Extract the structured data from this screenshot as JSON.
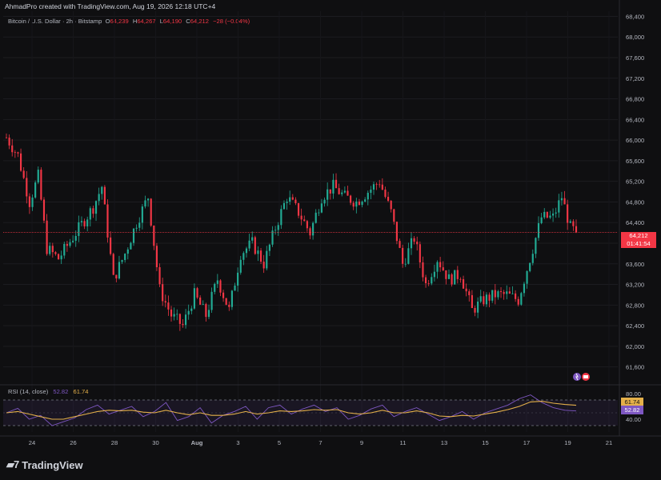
{
  "header": {
    "credit": "AhmadPro created with TradingView.com, Aug 19, 2026 12:18 UTC+4"
  },
  "legend": {
    "symbol": "Bitcoin / U.S. Dollar · 2h · Bitstamp",
    "open_label": "O",
    "open": "64,239",
    "high_label": "H",
    "high": "64,267",
    "low_label": "L",
    "low": "64,190",
    "close_label": "C",
    "close": "64,212",
    "change": "−28 (−0.04%)"
  },
  "price_tag": {
    "price": "64,212",
    "countdown": "01:41:54"
  },
  "rsi": {
    "label": "RSI (14, close)",
    "rsi_value": "52.82",
    "ma_value": "61.74"
  },
  "brand": {
    "name": "TradingView",
    "logo": "tradingview-logo-icon"
  },
  "colors": {
    "up": "#22ab94",
    "down": "#f23645",
    "rsi": "#7e57c2",
    "rsi_ma": "#e4b04a",
    "background": "#0f0f11"
  },
  "chart_data": [
    {
      "type": "candlestick",
      "title": "Bitcoin / U.S. Dollar · 2h · Bitstamp",
      "x_tick_labels": [
        "24",
        "26",
        "28",
        "30",
        "Aug",
        "3",
        "5",
        "7",
        "9",
        "11",
        "13",
        "15",
        "17",
        "19",
        "21"
      ],
      "y_tick_labels": [
        "61,600",
        "62,000",
        "62,400",
        "62,800",
        "63,200",
        "63,600",
        "64,000",
        "64,400",
        "64,800",
        "65,200",
        "65,600",
        "66,000",
        "66,400",
        "66,800",
        "67,200",
        "67,600",
        "68,000",
        "68,400"
      ],
      "ylim": [
        61300,
        68500
      ],
      "current_price": 64212,
      "trend_points": [
        [
          0,
          66050
        ],
        [
          4,
          65700
        ],
        [
          8,
          64800
        ],
        [
          11,
          65300
        ],
        [
          14,
          63900
        ],
        [
          18,
          63700
        ],
        [
          24,
          64200
        ],
        [
          30,
          64700
        ],
        [
          33,
          65100
        ],
        [
          37,
          63300
        ],
        [
          41,
          63800
        ],
        [
          45,
          64400
        ],
        [
          49,
          64900
        ],
        [
          53,
          63100
        ],
        [
          57,
          62600
        ],
        [
          61,
          62400
        ],
        [
          65,
          63000
        ],
        [
          69,
          62600
        ],
        [
          73,
          63300
        ],
        [
          77,
          62700
        ],
        [
          81,
          63800
        ],
        [
          85,
          64000
        ],
        [
          89,
          63600
        ],
        [
          93,
          64300
        ],
        [
          97,
          64900
        ],
        [
          101,
          64600
        ],
        [
          105,
          64200
        ],
        [
          109,
          64900
        ],
        [
          113,
          65100
        ],
        [
          117,
          64900
        ],
        [
          121,
          64800
        ],
        [
          125,
          65000
        ],
        [
          129,
          65200
        ],
        [
          133,
          64600
        ],
        [
          137,
          63600
        ],
        [
          141,
          64100
        ],
        [
          145,
          63200
        ],
        [
          149,
          63700
        ],
        [
          153,
          63300
        ],
        [
          157,
          63400
        ],
        [
          161,
          62700
        ],
        [
          165,
          62900
        ],
        [
          169,
          63000
        ],
        [
          173,
          63000
        ],
        [
          177,
          62900
        ],
        [
          181,
          63700
        ],
        [
          185,
          64500
        ],
        [
          189,
          64500
        ],
        [
          192,
          64900
        ],
        [
          195,
          64300
        ],
        [
          197,
          64212
        ]
      ]
    },
    {
      "type": "line",
      "title": "RSI (14, close)",
      "y_tick_labels": [
        "80.00",
        "40.00"
      ],
      "ylim": [
        20,
        90
      ],
      "bands": [
        30,
        70
      ],
      "series": [
        {
          "name": "RSI",
          "values": [
            50,
            57,
            40,
            46,
            30,
            36,
            42,
            55,
            62,
            48,
            54,
            60,
            44,
            52,
            66,
            38,
            44,
            58,
            34,
            46,
            52,
            60,
            40,
            58,
            62,
            48,
            56,
            62,
            52,
            58,
            40,
            46,
            56,
            62,
            44,
            52,
            58,
            48,
            38,
            44,
            52,
            40,
            50,
            56,
            62,
            72,
            78,
            66,
            58,
            54,
            52.82
          ]
        },
        {
          "name": "RSI-based MA",
          "values": [
            50,
            52,
            48,
            44,
            40,
            40,
            44,
            48,
            52,
            54,
            53,
            54,
            51,
            50,
            54,
            50,
            47,
            50,
            46,
            46,
            48,
            52,
            48,
            50,
            53,
            52,
            53,
            55,
            54,
            55,
            50,
            48,
            50,
            54,
            50,
            50,
            53,
            50,
            45,
            44,
            46,
            45,
            48,
            51,
            55,
            60,
            67,
            68,
            65,
            63,
            61.74
          ]
        }
      ]
    }
  ]
}
